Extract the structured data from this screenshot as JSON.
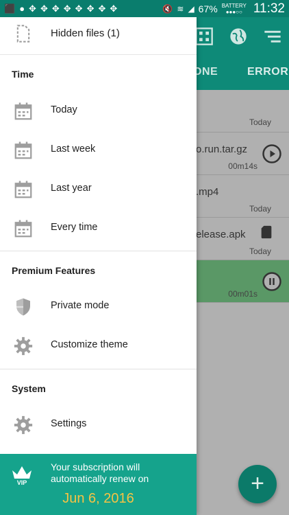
{
  "status_bar": {
    "battery_percent": "67%",
    "battery_label": "BATTERY",
    "time": "11:32"
  },
  "app": {
    "tabs": [
      "ONE",
      "ERROR"
    ],
    "rows": [
      {
        "name": "",
        "meta": "Today"
      },
      {
        "name": "o.run.tar.gz",
        "meta": "00m14s"
      },
      {
        "name": ".mp4",
        "meta": "Today"
      },
      {
        "name": "elease.apk",
        "meta": "Today"
      },
      {
        "name": "",
        "meta": "00m01s"
      }
    ],
    "fab_label": "+"
  },
  "drawer": {
    "hidden_files": "Hidden files  (1)",
    "sections": {
      "time": "Time",
      "premium": "Premium Features",
      "system": "System"
    },
    "time_items": [
      "Today",
      "Last week",
      "Last year",
      "Every time"
    ],
    "premium_items": [
      "Private mode",
      "Customize theme"
    ],
    "system_items": [
      "Settings"
    ],
    "subscription": {
      "message": "Your subscription will automatically renew on",
      "date": "Jun 6, 2016",
      "vip_label": "VIP"
    }
  },
  "colors": {
    "primary": "#0e8a78",
    "status_bar": "#0a7d6d",
    "banner": "#15a38c",
    "date": "#f6c343"
  }
}
